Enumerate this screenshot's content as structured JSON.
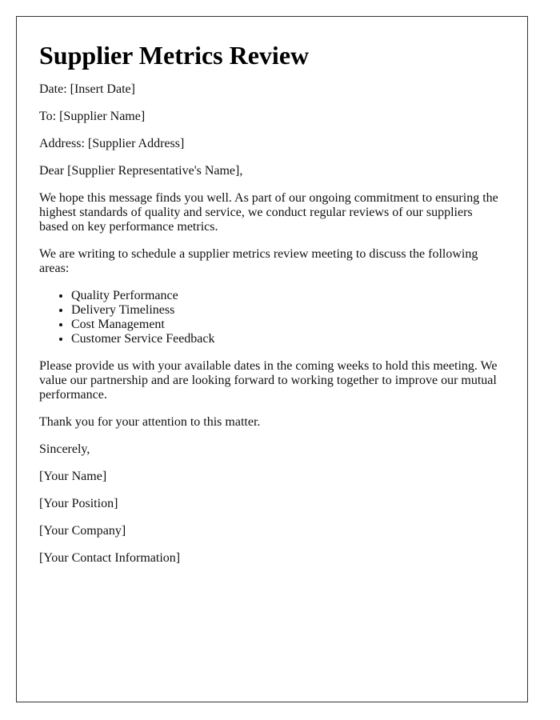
{
  "letter": {
    "title": "Supplier Metrics Review",
    "date_line": "Date: [Insert Date]",
    "to_line": "To: [Supplier Name]",
    "address_line": "Address: [Supplier Address]",
    "salutation": "Dear [Supplier Representative's Name],",
    "paragraph_intro": "We hope this message finds you well. As part of our ongoing commitment to ensuring the highest standards of quality and service, we conduct regular reviews of our suppliers based on key performance metrics.",
    "paragraph_purpose": "We are writing to schedule a supplier metrics review meeting to discuss the following areas:",
    "areas": [
      "Quality Performance",
      "Delivery Timeliness",
      "Cost Management",
      "Customer Service Feedback"
    ],
    "paragraph_request": "Please provide us with your available dates in the coming weeks to hold this meeting. We value our partnership and are looking forward to working together to improve our mutual performance.",
    "paragraph_thanks": "Thank you for your attention to this matter.",
    "closing": "Sincerely,",
    "signature": {
      "name": "[Your Name]",
      "position": "[Your Position]",
      "company": "[Your Company]",
      "contact": "[Your Contact Information]"
    }
  }
}
